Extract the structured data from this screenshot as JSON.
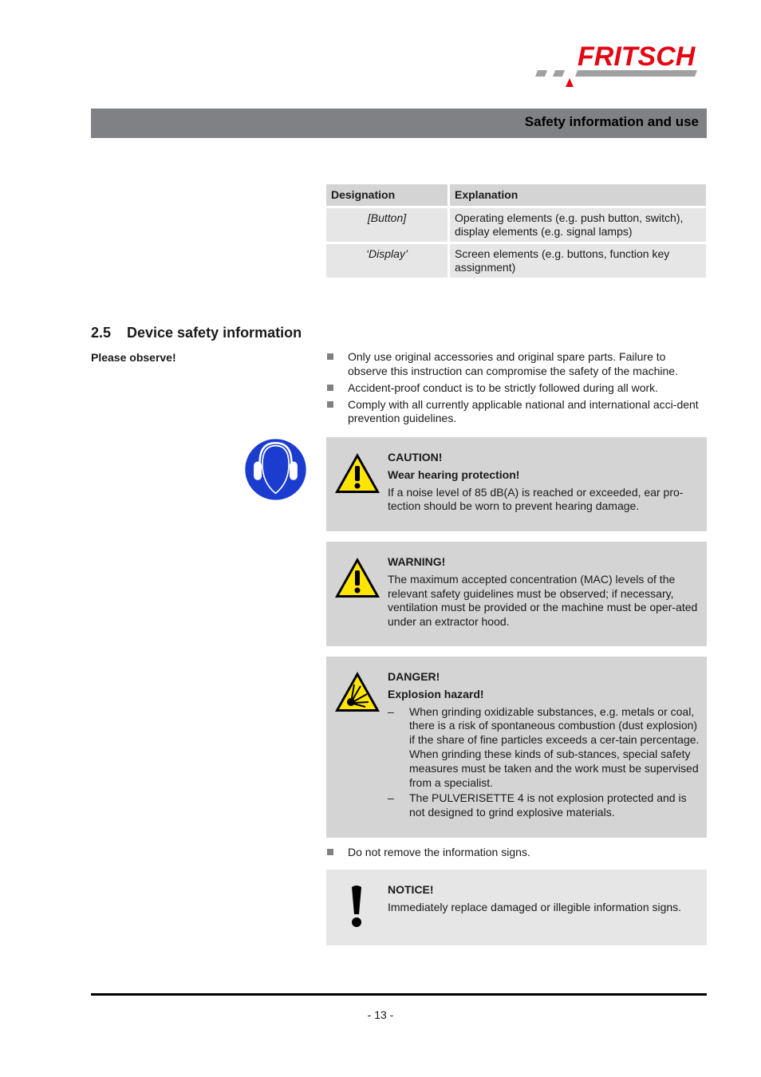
{
  "logo": {
    "text": "FRITSCH",
    "brand_color": "#e30613",
    "stripe_color": "#a0a0a0"
  },
  "header": {
    "title": "Safety information and use",
    "bar_color": "#808184"
  },
  "legend_table": {
    "headers": [
      "Designation",
      "Explanation"
    ],
    "rows": [
      {
        "designation": "[Button]",
        "explanation": "Operating elements (e.g. push button, switch), display elements (e.g. signal lamps)"
      },
      {
        "designation": "‘Display’",
        "explanation": "Screen elements (e.g. buttons, function key assignment)"
      }
    ]
  },
  "section": {
    "number": "2.5",
    "title": "Device safety information"
  },
  "side_label": "Please observe!",
  "bullets_top": [
    "Only use original accessories and original spare parts. Failure to observe this instruction can compromise the safety of the machine.",
    "Accident-proof conduct is to be strictly followed during all work.",
    "Comply with all currently applicable national and international acci-dent prevention guidelines."
  ],
  "caution": {
    "icon": "warning-triangle-icon",
    "side_icon": "hearing-protection-icon",
    "title": "CAUTION!",
    "subtitle": "Wear hearing protection!",
    "text": "If a noise level of 85 dB(A) is reached or exceeded, ear pro-tection should be worn to prevent hearing damage."
  },
  "warning": {
    "icon": "warning-triangle-icon",
    "title": "WARNING!",
    "text": "The maximum accepted concentration (MAC) levels of the relevant safety guidelines must be observed; if necessary, ventilation must be provided or the machine must be oper-ated under an extractor hood."
  },
  "danger": {
    "icon": "explosion-hazard-icon",
    "title": "DANGER!",
    "subtitle": "Explosion hazard!",
    "items": [
      "When grinding oxidizable substances, e.g. metals or coal, there is a risk of spontaneous combustion (dust explosion) if the share of fine particles exceeds a cer-tain percentage. When grinding these kinds of sub-stances, special safety measures must be taken and the work must be supervised from a specialist.",
      "The PULVERISETTE 4 is not explosion protected and is not designed to grind explosive materials."
    ],
    "dash": "–"
  },
  "bullets_bottom": [
    "Do not remove the information signs."
  ],
  "notice": {
    "icon": "exclamation-icon",
    "title": "NOTICE!",
    "text": "Immediately replace damaged or illegible information signs."
  },
  "footer": {
    "page": "- 13 -"
  }
}
